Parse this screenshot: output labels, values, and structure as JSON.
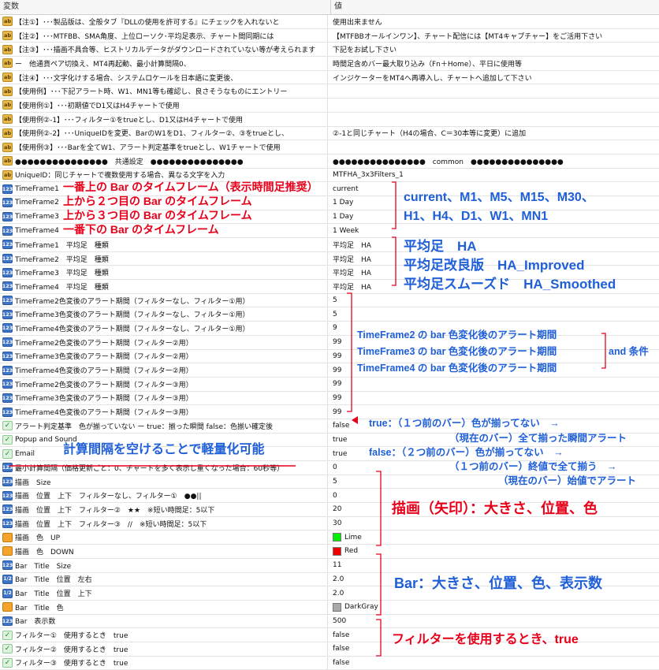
{
  "header": {
    "col1": "変数",
    "col2": "値"
  },
  "rows": [
    {
      "icon": "ab",
      "label": "【注①】･･･製品版は、全般タブ『DLLの使用を許可する』にチェックを入れないと",
      "value": "使用出来ません"
    },
    {
      "icon": "ab",
      "label": "【注②】･･･MTFBB、SMA角度、上位ローソク･平均足表示、チャート間同期には",
      "value": "【MTFBBオールインワン】、チャート配信には【MT4キャプチャー】をご活用下さい"
    },
    {
      "icon": "ab",
      "label": "【注③】･･･描画不具合等、ヒストリカルデータがダウンロードされていない等が考えられます",
      "value": "下記をお試し下さい"
    },
    {
      "icon": "ab",
      "label": "ー　他通貨ペア切換え、MT4再起動、最小計算間隔0、",
      "value": "時間足含めバー最大取り込み（Fn＋Home）、平日に使用等"
    },
    {
      "icon": "ab",
      "label": "【注④】･･･文字化けする場合、システムロケールを日本語に変更後、",
      "value": "インジケーターをMT4へ再導入し、チャートへ追加して下さい"
    },
    {
      "icon": "ab",
      "label": "【使用例】･･･下記アラート時、W1、MN1等も確認し、良さそうなものにエントリー",
      "value": ""
    },
    {
      "icon": "ab",
      "label": "【使用例①】･･･初期値でD1又はH4チャートで使用",
      "value": ""
    },
    {
      "icon": "ab",
      "label": "【使用例②-1】･･･フィルター①をtrueとし、D1又はH4チャートで使用",
      "value": ""
    },
    {
      "icon": "ab",
      "label": "【使用例②-2】･･･UniqueIDを変更、BarのW1をD1、フィルター②、③をtrueとし、",
      "value": "②-1と同じチャート（H4の場合、C＝30本等に変更）に追加"
    },
    {
      "icon": "ab",
      "label": "【使用例③】･･･Barを全てW1、アラート判定基準をtrueとし、W1チャートで使用",
      "value": ""
    },
    {
      "icon": "ab",
      "label": "●●●●●●●●●●●●●●●　共通設定　●●●●●●●●●●●●●●●",
      "value": "●●●●●●●●●●●●●●●　common　●●●●●●●●●●●●●●●"
    },
    {
      "icon": "ab",
      "label": "UniqueID：同じチャートで複数使用する場合、異なる文字を入力",
      "value": "MTFHA_3x3Filters_1"
    },
    {
      "icon": "123",
      "label": "TimeFrame1",
      "value": "current"
    },
    {
      "icon": "123",
      "label": "TimeFrame2",
      "value": "1 Day"
    },
    {
      "icon": "123",
      "label": "TimeFrame3",
      "value": "1 Day"
    },
    {
      "icon": "123",
      "label": "TimeFrame4",
      "value": "1 Week"
    },
    {
      "icon": "123",
      "label": "TimeFrame1　平均足　種類",
      "value": "平均足　HA"
    },
    {
      "icon": "123",
      "label": "TimeFrame2　平均足　種類",
      "value": "平均足　HA"
    },
    {
      "icon": "123",
      "label": "TimeFrame3　平均足　種類",
      "value": "平均足　HA"
    },
    {
      "icon": "123",
      "label": "TimeFrame4　平均足　種類",
      "value": "平均足　HA"
    },
    {
      "icon": "123",
      "label": "TimeFrame2色変後のアラート期間（フィルターなし、フィルター①用）",
      "value": "5"
    },
    {
      "icon": "123",
      "label": "TimeFrame3色変後のアラート期間（フィルターなし、フィルター①用）",
      "value": "5"
    },
    {
      "icon": "123",
      "label": "TimeFrame4色変後のアラート期間（フィルターなし、フィルター①用）",
      "value": "9"
    },
    {
      "icon": "123",
      "label": "TimeFrame2色変後のアラート期間（フィルター②用）",
      "value": "99"
    },
    {
      "icon": "123",
      "label": "TimeFrame3色変後のアラート期間（フィルター②用）",
      "value": "99"
    },
    {
      "icon": "123",
      "label": "TimeFrame4色変後のアラート期間（フィルター②用）",
      "value": "99"
    },
    {
      "icon": "123",
      "label": "TimeFrame2色変後のアラート期間（フィルター③用）",
      "value": "99"
    },
    {
      "icon": "123",
      "label": "TimeFrame3色変後のアラート期間（フィルター③用）",
      "value": "99"
    },
    {
      "icon": "123",
      "label": "TimeFrame4色変後のアラート期間（フィルター③用）",
      "value": "99"
    },
    {
      "icon": "bool",
      "label": "アラート判定基準　色が揃っていない ー true：揃った瞬間 false：色揃い確定後",
      "value": "false"
    },
    {
      "icon": "bool",
      "label": "Popup and Sound",
      "value": "true"
    },
    {
      "icon": "bool",
      "label": "Email",
      "value": "true"
    },
    {
      "icon": "123",
      "label": "最小計算間隔（価格更新ごと：0、チャートを多く表示し重くなった場合：60秒等）",
      "value": "0"
    },
    {
      "icon": "123",
      "label": "描画　Size",
      "value": "5"
    },
    {
      "icon": "123",
      "label": "描画　位置　上下　フィルターなし、フィルター①　●●||",
      "value": "0"
    },
    {
      "icon": "123",
      "label": "描画　位置　上下　フィルター②　★★　※短い時間足：5以下",
      "value": "20"
    },
    {
      "icon": "123",
      "label": "描画　位置　上下　フィルター③　//　※短い時間足：5以下",
      "value": "30"
    },
    {
      "icon": "clr",
      "label": "描画　色　UP",
      "value": "Lime",
      "swatch": "#00ee00"
    },
    {
      "icon": "clr",
      "label": "描画　色　DOWN",
      "value": "Red",
      "swatch": "#ee0000"
    },
    {
      "icon": "123",
      "label": "Bar　Title　Size",
      "value": "11"
    },
    {
      "icon": "dbl",
      "label": "Bar　Title　位置　左右",
      "value": "2.0"
    },
    {
      "icon": "dbl",
      "label": "Bar　Title　位置　上下",
      "value": "2.0"
    },
    {
      "icon": "clr",
      "label": "Bar　Title　色",
      "value": "DarkGray",
      "swatch": "#a9a9a9"
    },
    {
      "icon": "123",
      "label": "Bar　表示数",
      "value": "500"
    },
    {
      "icon": "bool",
      "label": "フィルター①　使用するとき　true",
      "value": "false"
    },
    {
      "icon": "bool",
      "label": "フィルター②　使用するとき　true",
      "value": "false"
    },
    {
      "icon": "bool",
      "label": "フィルター③　使用するとき　true",
      "value": "false"
    }
  ],
  "annotations": {
    "tf1": "一番上の Bar のタイムフレーム（表示時間足推奨）",
    "tf2": "上から２つ目の Bar のタイムフレーム",
    "tf3": "上から３つ目の Bar のタイムフレーム",
    "tf4": "一番下の Bar のタイムフレーム",
    "tf_vals1": "current、M1、M5、M15、M30、",
    "tf_vals2": "H1、H4、D1、W1、MN1",
    "ha1": "平均足　HA",
    "ha2": "平均足改良版　HA_Improved",
    "ha3": "平均足スムーズド　HA_Smoothed",
    "alert2": "TimeFrame2 の bar 色変化後のアラート期間",
    "alert3": "TimeFrame3 の bar 色変化後のアラート期間",
    "alert4": "TimeFrame4 の bar 色変化後のアラート期間",
    "and_cond": "and 条件",
    "true1": "true：（１つ前のバー）色が揃ってない　→",
    "true2": "（現在のバー）全て揃った瞬間アラート",
    "false1": "false：（２つ前のバー）色が揃ってない　→",
    "false2": "（１つ前のバー）終値で全て揃う　→",
    "false3": "（現在のバー）始値でアラート",
    "calc": "計算間隔を空けることで軽量化可能",
    "draw": "描画（矢印）：大きさ、位置、色",
    "bar": "Bar：大きさ、位置、色、表示数",
    "filter": "フィルターを使用するとき、true"
  }
}
